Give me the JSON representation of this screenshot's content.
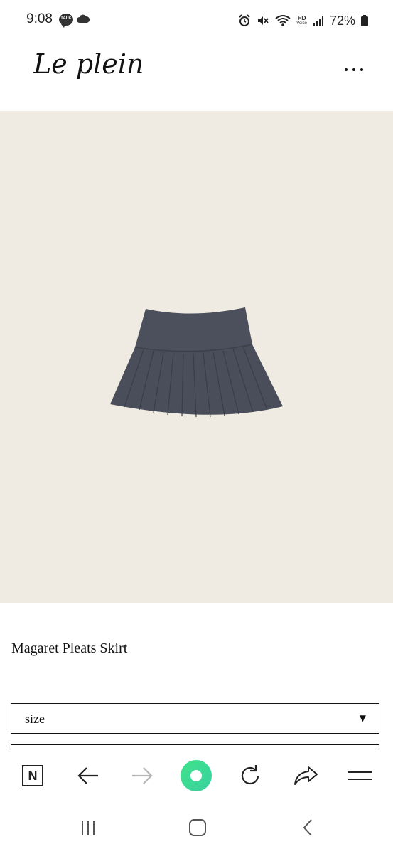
{
  "status_bar": {
    "time": "9:08",
    "talk_badge": "TALK",
    "hd_label_top": "HD",
    "hd_label_bottom": "Voice",
    "battery": "72%"
  },
  "header": {
    "logo": "Le plein"
  },
  "product": {
    "image_icon": "skirt-illustration",
    "title": "Magaret Pleats Skirt",
    "size_select": {
      "label": "size",
      "caret": "▼"
    }
  },
  "browser_toolbar": {
    "n_label": "N"
  },
  "colors": {
    "image_bg": "#efebe2",
    "accent_green": "#3ee38a",
    "skirt": "#4b4f5b"
  }
}
